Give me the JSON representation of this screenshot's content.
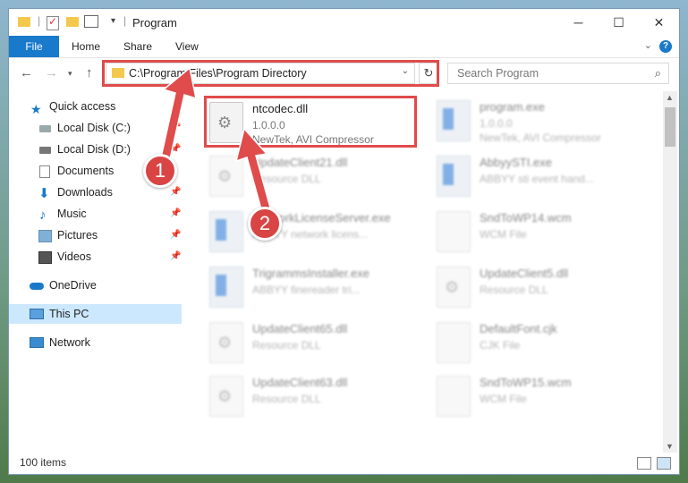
{
  "window": {
    "title": "Program"
  },
  "ribbon": {
    "tabs": [
      "File",
      "Home",
      "Share",
      "View"
    ]
  },
  "address": {
    "path": "C:\\Program Files\\Program Directory"
  },
  "search": {
    "placeholder": "Search Program"
  },
  "sidebar": {
    "items": [
      {
        "label": "Quick access",
        "icon": "star-icon"
      },
      {
        "label": "Local Disk (C:)",
        "icon": "drive-icon"
      },
      {
        "label": "Local Disk (D:)",
        "icon": "drive-icon"
      },
      {
        "label": "Documents",
        "icon": "documents-icon"
      },
      {
        "label": "Downloads",
        "icon": "download-icon"
      },
      {
        "label": "Music",
        "icon": "music-icon"
      },
      {
        "label": "Pictures",
        "icon": "pictures-icon"
      },
      {
        "label": "Videos",
        "icon": "videos-icon"
      },
      {
        "label": "OneDrive",
        "icon": "cloud-icon"
      },
      {
        "label": "This PC",
        "icon": "computer-icon"
      },
      {
        "label": "Network",
        "icon": "network-icon"
      }
    ]
  },
  "files": [
    {
      "name": "ntcodec.dll",
      "line1": "1.0.0.0",
      "line2": "NewTek, AVI Compressor"
    },
    {
      "name": "program.exe",
      "line1": "1.0.0.0",
      "line2": "NewTek, AVI Compressor"
    },
    {
      "name": "UpdateClient21.dll",
      "line1": "Resource DLL",
      "line2": ""
    },
    {
      "name": "AbbyySTI.exe",
      "line1": "ABBYY sti event hand...",
      "line2": ""
    },
    {
      "name": "NetworkLicenseServer.exe",
      "line1": "ABBYY network licens...",
      "line2": ""
    },
    {
      "name": "SndToWP14.wcm",
      "line1": "WCM File",
      "line2": ""
    },
    {
      "name": "TrigrammsInstaller.exe",
      "line1": "ABBYY finereader tri...",
      "line2": ""
    },
    {
      "name": "UpdateClient5.dll",
      "line1": "Resource DLL",
      "line2": ""
    },
    {
      "name": "UpdateClient65.dll",
      "line1": "Resource DLL",
      "line2": ""
    },
    {
      "name": "DefaultFont.cjk",
      "line1": "CJK File",
      "line2": ""
    },
    {
      "name": "UpdateClient63.dll",
      "line1": "Resource DLL",
      "line2": ""
    },
    {
      "name": "SndToWP15.wcm",
      "line1": "WCM File",
      "line2": ""
    }
  ],
  "status": {
    "item_count": "100 items"
  },
  "markers": [
    "1",
    "2"
  ],
  "colors": {
    "accent": "#1979ca",
    "highlight": "#e04b4b",
    "marker": "#d94444"
  }
}
